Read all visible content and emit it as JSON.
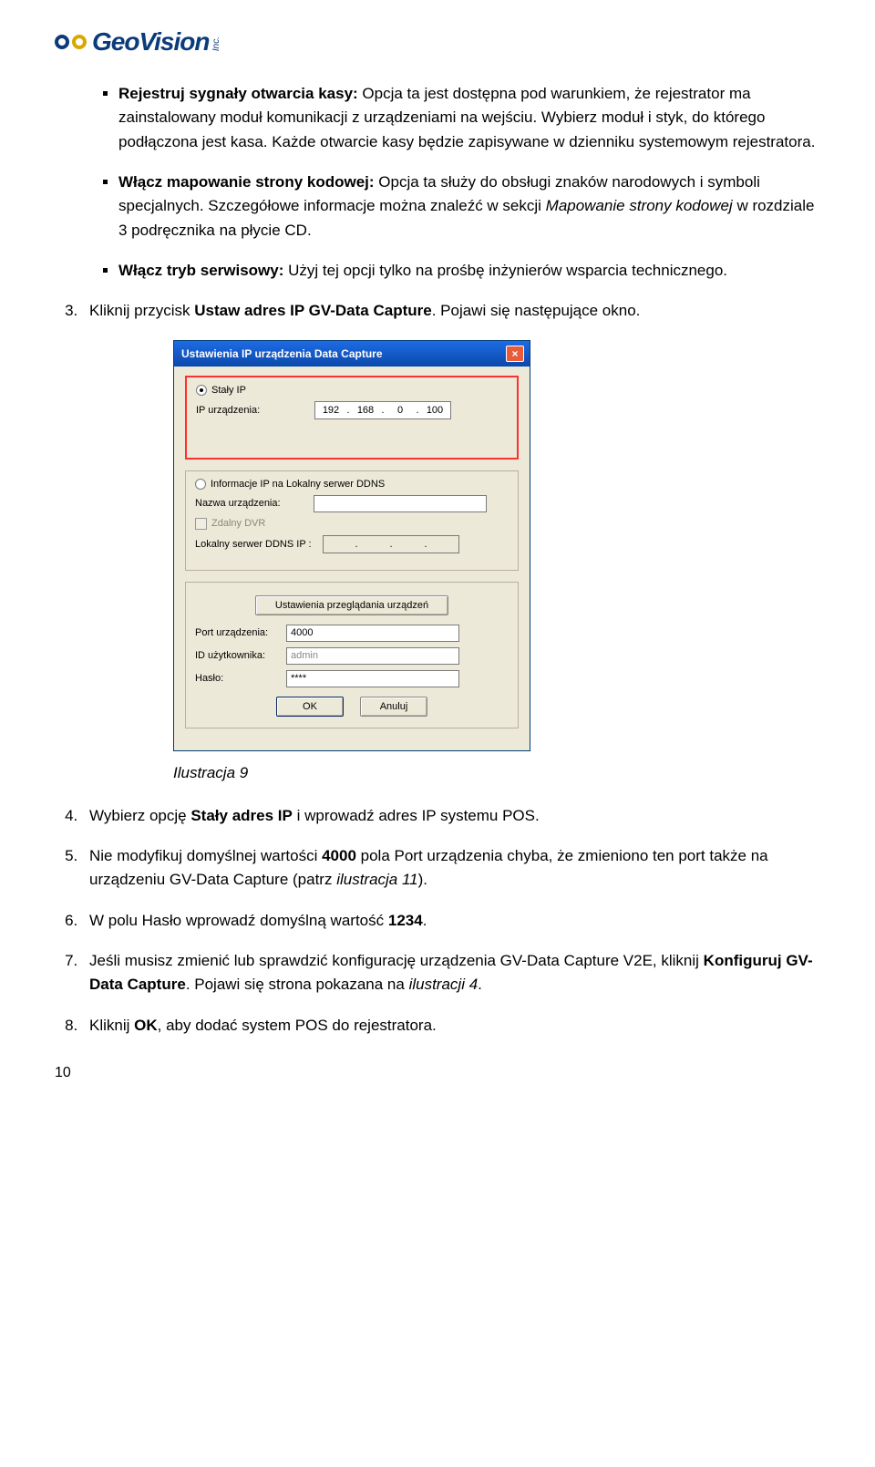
{
  "logo": {
    "brand": "GeoVision",
    "inc": "Inc."
  },
  "bullets": {
    "b1": {
      "lead": "Rejestruj sygnały otwarcia kasy:",
      "text": " Opcja ta jest dostępna pod warunkiem, że rejestrator ma zainstalowany moduł komunikacji z urządzeniami na wejściu. Wybierz moduł i styk, do którego podłączona jest kasa. Każde otwarcie kasy będzie zapisywane w dzienniku systemowym rejestratora."
    },
    "b2": {
      "lead": "Włącz mapowanie strony kodowej:",
      "text1": " Opcja ta służy do obsługi znaków narodowych i symboli specjalnych. Szczegółowe informacje można znaleźć w sekcji ",
      "italic": "Mapowanie strony kodowej",
      "text2": " w rozdziale 3 podręcznika na płycie CD."
    },
    "b3": {
      "lead": "Włącz tryb serwisowy:",
      "text": " Użyj tej opcji tylko na prośbę inżynierów wsparcia technicznego."
    }
  },
  "steps": {
    "s3": {
      "pre": "Kliknij przycisk ",
      "bold": "Ustaw adres IP GV-Data Capture",
      "post": ". Pojawi się następujące okno."
    },
    "s4": {
      "pre": "Wybierz opcję ",
      "bold": "Stały adres IP",
      "post": " i wprowadź adres IP systemu POS."
    },
    "s5": {
      "pre": "Nie modyfikuj domyślnej wartości ",
      "bold": "4000",
      "mid": " pola Port urządzenia chyba, że zmieniono ten port także na urządzeniu GV-Data Capture (patrz ",
      "italic": "ilustracja 11",
      "post": ")."
    },
    "s6": {
      "pre": "W polu Hasło wprowadź domyślną wartość ",
      "bold": "1234",
      "post": "."
    },
    "s7": {
      "pre": "Jeśli musisz zmienić lub sprawdzić konfigurację urządzenia GV-Data Capture V2E, kliknij ",
      "bold": "Konfiguruj GV-Data Capture",
      "mid": ". Pojawi się strona pokazana na ",
      "italic": "ilustracji 4",
      "post": "."
    },
    "s8": {
      "pre": "Kliknij ",
      "bold": "OK",
      "post": ", aby dodać system POS do rejestratora."
    }
  },
  "caption": "Ilustracja 9",
  "dialog": {
    "title": "Ustawienia IP urządzenia Data Capture",
    "close": "×",
    "static_ip_label": "Stały IP",
    "device_ip_label": "IP urządzenia:",
    "ip": {
      "o1": "192",
      "o2": "168",
      "o3": "0",
      "o4": "100",
      "dot": "."
    },
    "ddns_section_label": "Informacje IP na Lokalny serwer DDNS",
    "device_name_label": "Nazwa urządzenia:",
    "remote_dvr_label": "Zdalny DVR",
    "local_ddns_ip_label": "Lokalny serwer DDNS IP :",
    "browse_btn": "Ustawienia przeglądania urządzeń",
    "port_label": "Port urządzenia:",
    "port_value": "4000",
    "user_label": "ID użytkownika:",
    "user_value": "admin",
    "pass_label": "Hasło:",
    "pass_value": "****",
    "ok": "OK",
    "cancel": "Anuluj"
  },
  "pagenum": "10"
}
